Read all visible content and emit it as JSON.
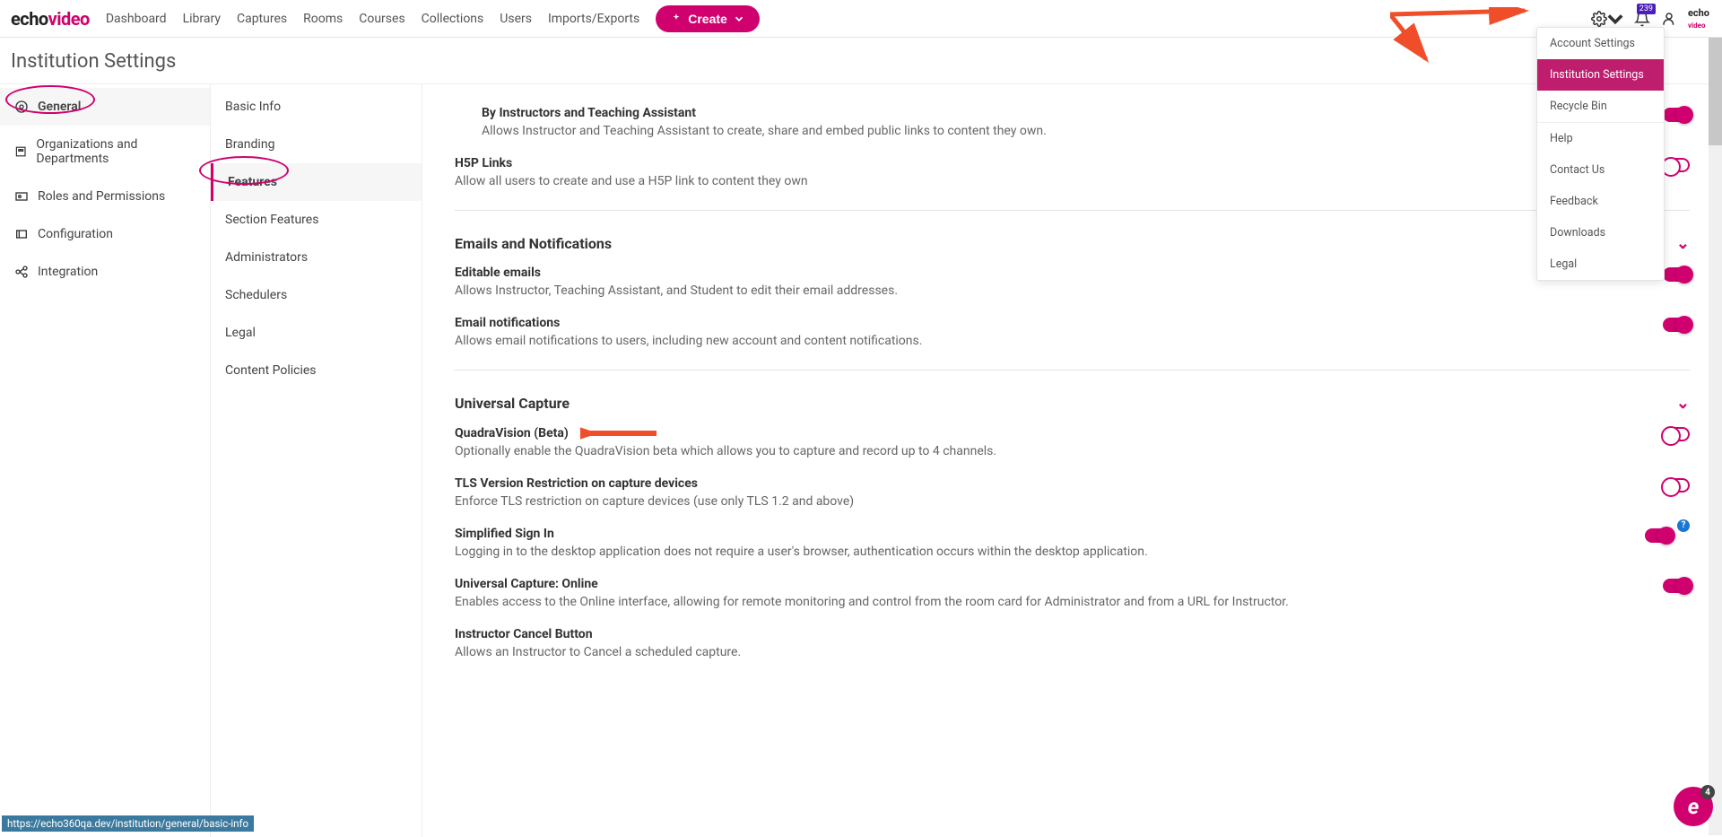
{
  "brand": {
    "part1": "echo",
    "part2": "video"
  },
  "nav": [
    "Dashboard",
    "Library",
    "Captures",
    "Rooms",
    "Courses",
    "Collections",
    "Users",
    "Imports/Exports"
  ],
  "create": "Create",
  "badge": "239",
  "pageTitle": "Institution Settings",
  "leftNav": [
    "General",
    "Organizations and Departments",
    "Roles and Permissions",
    "Configuration",
    "Integration"
  ],
  "midNav": [
    "Basic Info",
    "Branding",
    "Features",
    "Section Features",
    "Administrators",
    "Schedulers",
    "Legal",
    "Content Policies"
  ],
  "settingsMenu": [
    "Account Settings",
    "Institution Settings",
    "Recycle Bin",
    "Help",
    "Contact Us",
    "Feedback",
    "Downloads",
    "Legal"
  ],
  "content": {
    "top": {
      "t1": "By Instructors and Teaching Assistant",
      "d1": "Allows Instructor and Teaching Assistant to create, share and embed public links to content they own.",
      "t2": "H5P Links",
      "d2": "Allow all users to create and use a H5P link to content they own"
    },
    "emails": {
      "h": "Emails and Notifications",
      "t1": "Editable emails",
      "d1": "Allows Instructor, Teaching Assistant, and Student to edit their email addresses.",
      "t2": "Email notifications",
      "d2": "Allows email notifications to users, including new account and content notifications."
    },
    "uc": {
      "h": "Universal Capture",
      "t1": "QuadraVision (Beta)",
      "d1": "Optionally enable the QuadraVision beta which allows you to capture and record up to 4 channels.",
      "t2": "TLS Version Restriction on capture devices",
      "d2": "Enforce TLS restriction on capture devices (use only TLS 1.2 and above)",
      "t3": "Simplified Sign In",
      "d3": "Logging in to the desktop application does not require a user's browser, authentication occurs within the desktop application.",
      "t4": "Universal Capture: Online",
      "d4": "Enables access to the Online interface, allowing for remote monitoring and control from the room card for Administrator and from a URL for Instructor.",
      "t5": "Instructor Cancel Button",
      "d5": "Allows an Instructor to Cancel a scheduled capture."
    }
  },
  "statusUrl": "https://echo360qa.dev/institution/general/basic-info",
  "fabCount": "4",
  "helpQ": "?"
}
